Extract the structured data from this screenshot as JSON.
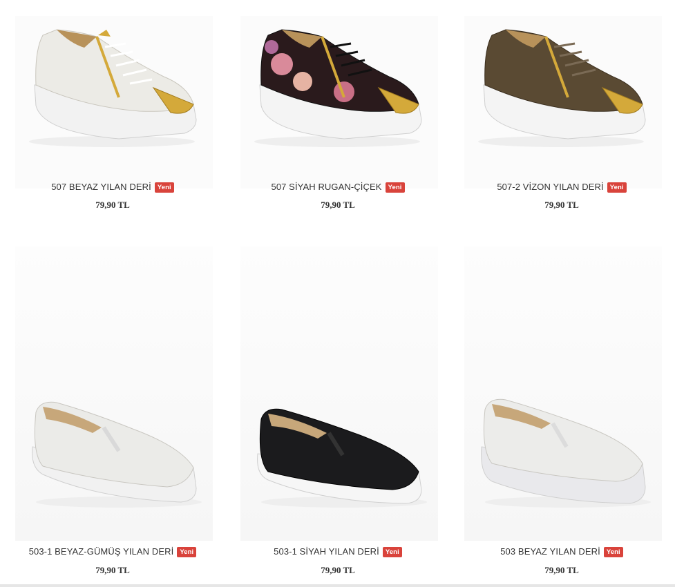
{
  "products": [
    {
      "name": "507 BEYAZ YILAN DERİ",
      "badge": "Yeni",
      "price": "79,90 TL",
      "style": "sneaker",
      "color": "white"
    },
    {
      "name": "507 SİYAH RUGAN-ÇİÇEK",
      "badge": "Yeni",
      "price": "79,90 TL",
      "style": "sneaker",
      "color": "floral-black"
    },
    {
      "name": "507-2 VİZON YILAN DERİ",
      "badge": "Yeni",
      "price": "79,90 TL",
      "style": "sneaker",
      "color": "mink-brown"
    },
    {
      "name": "503-1 BEYAZ-GÜMÜŞ YILAN DERİ",
      "badge": "Yeni",
      "price": "79,90 TL",
      "style": "slip-on",
      "color": "white-silver"
    },
    {
      "name": "503-1 SİYAH YILAN DERİ",
      "badge": "Yeni",
      "price": "79,90 TL",
      "style": "slip-on",
      "color": "black"
    },
    {
      "name": "503 BEYAZ YILAN DERİ",
      "badge": "Yeni",
      "price": "79,90 TL",
      "style": "slip-on",
      "color": "white"
    }
  ],
  "colors": {
    "badge": "#d9433b",
    "text": "#333333",
    "gold": "#d4a93a"
  }
}
